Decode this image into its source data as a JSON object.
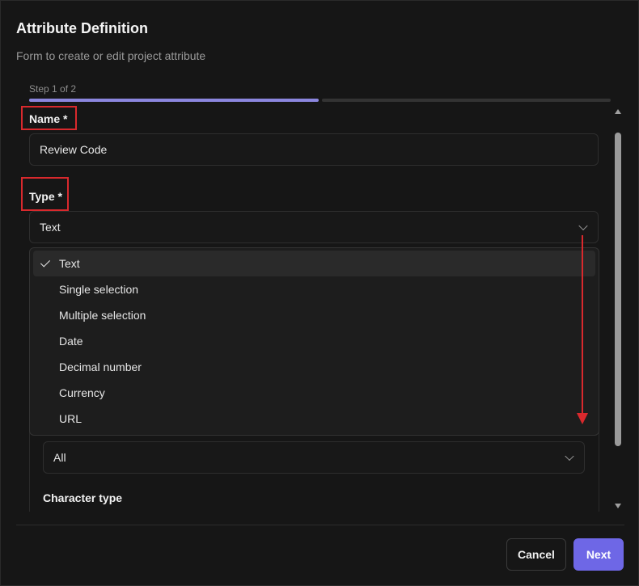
{
  "dialog": {
    "title": "Attribute Definition",
    "subtitle": "Form to create or edit project attribute",
    "step_label": "Step 1 of 2",
    "progress": {
      "current_step": 1,
      "total_steps": 2,
      "accent_color": "#8b86de"
    }
  },
  "form": {
    "name": {
      "label": "Name *",
      "value": "Review Code"
    },
    "type": {
      "label": "Type *",
      "value": "Text",
      "options": [
        "Text",
        "Single selection",
        "Multiple selection",
        "Date",
        "Decimal number",
        "Currency",
        "URL"
      ],
      "selected_index": 0
    },
    "nested": {
      "select_value": "All",
      "character_type_label": "Character type"
    }
  },
  "annotations": {
    "highlight_color": "#d9292d"
  },
  "footer": {
    "cancel_label": "Cancel",
    "next_label": "Next",
    "primary_color": "#6e67e6"
  }
}
